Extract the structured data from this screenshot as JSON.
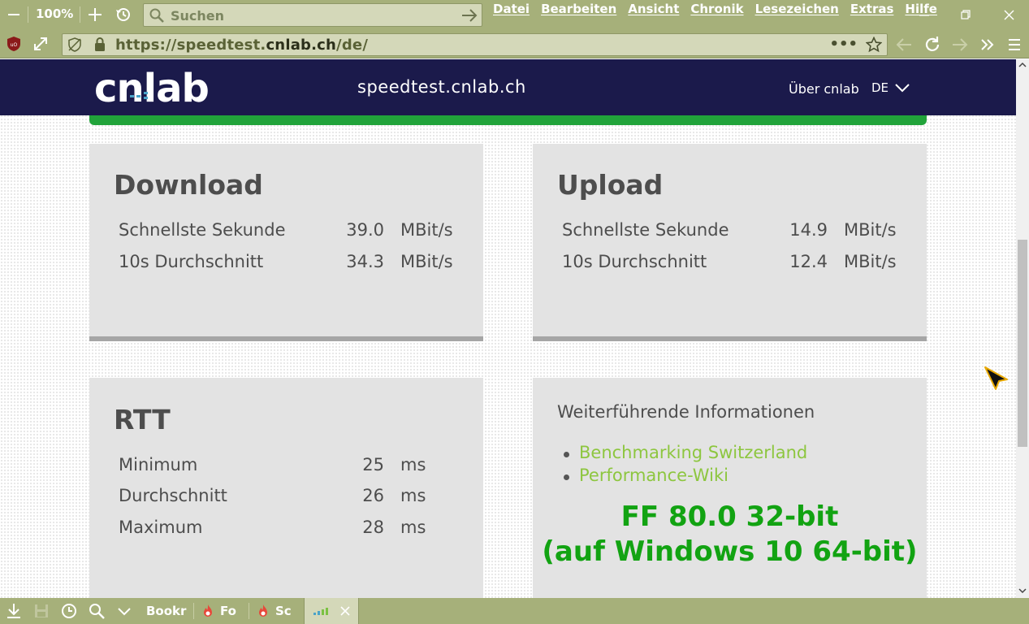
{
  "browser": {
    "zoom_level": "100%",
    "search_placeholder": "Suchen",
    "menu": [
      "Datei",
      "Bearbeiten",
      "Ansicht",
      "Chronik",
      "Lesezeichen",
      "Extras",
      "Hilfe"
    ],
    "url_prefix": "https://speedtest.",
    "url_host": "cnlab.ch",
    "url_suffix": "/de/",
    "url_more": "•••",
    "tabs": [
      {
        "label": "Bookr"
      },
      {
        "label": "Fo"
      },
      {
        "label": "Sc"
      },
      {
        "label": ""
      }
    ]
  },
  "site": {
    "logo_text": "cnlab",
    "title": "speedtest.cnlab.ch",
    "about_link": "Über cnlab",
    "language": "DE",
    "colors": {
      "header_bg": "#1b1a4b",
      "accent_green": "#21a33a",
      "link_green": "#8dc63f"
    }
  },
  "download": {
    "title": "Download",
    "rows": [
      {
        "label": "Schnellste Sekunde",
        "value": "39.0",
        "unit": "MBit/s"
      },
      {
        "label": "10s Durchschnitt",
        "value": "34.3",
        "unit": "MBit/s"
      }
    ]
  },
  "upload": {
    "title": "Upload",
    "rows": [
      {
        "label": "Schnellste Sekunde",
        "value": "14.9",
        "unit": "MBit/s"
      },
      {
        "label": "10s Durchschnitt",
        "value": "12.4",
        "unit": "MBit/s"
      }
    ]
  },
  "rtt": {
    "title": "RTT",
    "rows": [
      {
        "label": "Minimum",
        "value": "25",
        "unit": "ms"
      },
      {
        "label": "Durchschnitt",
        "value": "26",
        "unit": "ms"
      },
      {
        "label": "Maximum",
        "value": "28",
        "unit": "ms"
      }
    ]
  },
  "info": {
    "title": "Weiterführende Informationen",
    "links": [
      "Benchmarking Switzerland",
      "Performance-Wiki"
    ],
    "note_line1": "FF 80.0 32-bit",
    "note_line2": "(auf Windows 10 64-bit)"
  }
}
